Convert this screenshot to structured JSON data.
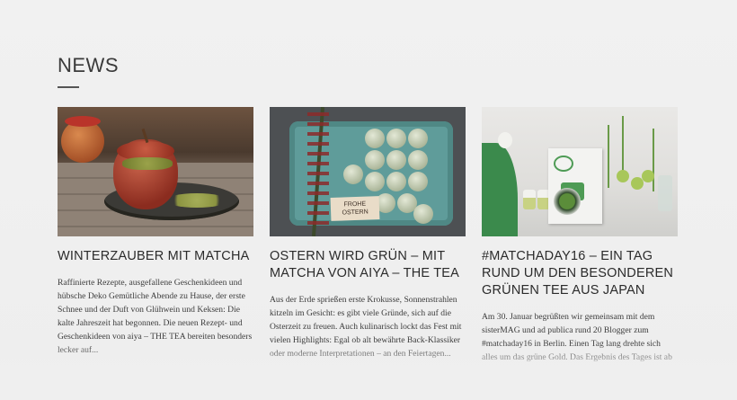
{
  "section": {
    "heading": "NEWS"
  },
  "articles": [
    {
      "title": "WINTERZAUBER MIT MATCHA",
      "excerpt": "Raffinierte Rezepte, ausgefallene Geschenkideen und hübsche Deko Gemütliche Abende zu Hause, der erste Schnee und der Duft von Glühwein und Keksen: Die kalte Jahreszeit hat begonnen. Die neuen Rezept- und Geschenkideen von aiya – THE TEA bereiten besonders lecker auf...",
      "image": "matcha-apple-photo"
    },
    {
      "title": "OSTERN WIRD GRÜN – MIT MATCHA VON AIYA – THE TEA",
      "excerpt": "Aus der Erde sprießen erste Krokusse, Sonnenstrahlen kitzeln im Gesicht: es gibt viele Gründe, sich auf die Osterzeit zu freuen. Auch kulinarisch lockt das Fest mit vielen Highlights: Egal ob alt bewährte Back-Klassiker oder moderne Interpretationen – an den Feiertagen...",
      "image": "easter-egg-carton-photo",
      "tag_text": "FROHE OSTERN"
    },
    {
      "title": "#MATCHADAY16 – EIN TAG RUND UM DEN BESONDEREN GRÜNEN TEE AUS JAPAN",
      "excerpt": "Am 30. Januar begrüßten wir gemeinsam mit dem sisterMAG und ad publica rund 20 Blogger zum #matchaday16 in Berlin. Einen Tag lang drehte sich alles um das grüne Gold. Das Ergebnis des Tages ist ab",
      "image": "matcha-table-photo"
    }
  ],
  "colors": {
    "background": "#efefef",
    "text": "#2b2b2b",
    "accent_green": "#4e9b55"
  }
}
